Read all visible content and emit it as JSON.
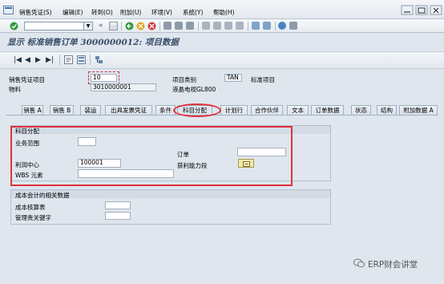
{
  "menu": {
    "items": [
      "销售凭证(S)",
      "编辑(E)",
      "转到(O)",
      "附加(U)",
      "环境(V)",
      "系统(Y)",
      "帮助(H)"
    ]
  },
  "toolbar": {
    "back_chevrons": "«",
    "icons": [
      "enter-icon",
      "save-icon",
      "back-icon",
      "exit-icon",
      "cancel-icon",
      "print-icon",
      "find-icon",
      "find-next-icon",
      "first-page-icon",
      "previous-page-icon",
      "next-page-icon",
      "last-page-icon",
      "create-session-icon",
      "shortcut-icon",
      "help-icon",
      "customize-layout-icon"
    ]
  },
  "title": "显示 标准销售订单 3000000012: 项目数据",
  "nav": [
    "|◀",
    "◀",
    "▶",
    "▶|"
  ],
  "header": {
    "item_label": "销售凭证项目",
    "item_value": "10",
    "material_label": "物料",
    "material_value": "3010000001",
    "item_category_label": "项目类别",
    "item_category_value": "TAN",
    "item_category_text": "标准项目",
    "material_desc": "液晶电视GL800"
  },
  "tabs": [
    "销售 A",
    "销售 B",
    "装运",
    "出具发票凭证",
    "条件",
    "科目分配",
    "计划行",
    "合作伙伴",
    "文本",
    "订单数据",
    "状态",
    "结构",
    "附加数据 A"
  ],
  "active_tab": "科目分配",
  "account_assignment": {
    "title": "科目分配",
    "business_area_label": "业务范围",
    "business_area_value": "",
    "order_label": "订单",
    "order_value": "",
    "profit_center_label": "利润中心",
    "profit_center_value": "100001",
    "profitability_segment_label": "获利能力段",
    "wbs_label": "WBS 元素",
    "wbs_value": ""
  },
  "cost_accounting": {
    "title": "成本会计的相关数据",
    "cost_estimate_label": "成本核算表",
    "cost_estimate_value": "",
    "responsibility_label": "管理责关键字",
    "responsibility_value": ""
  },
  "watermark": "ERP财会讲堂"
}
